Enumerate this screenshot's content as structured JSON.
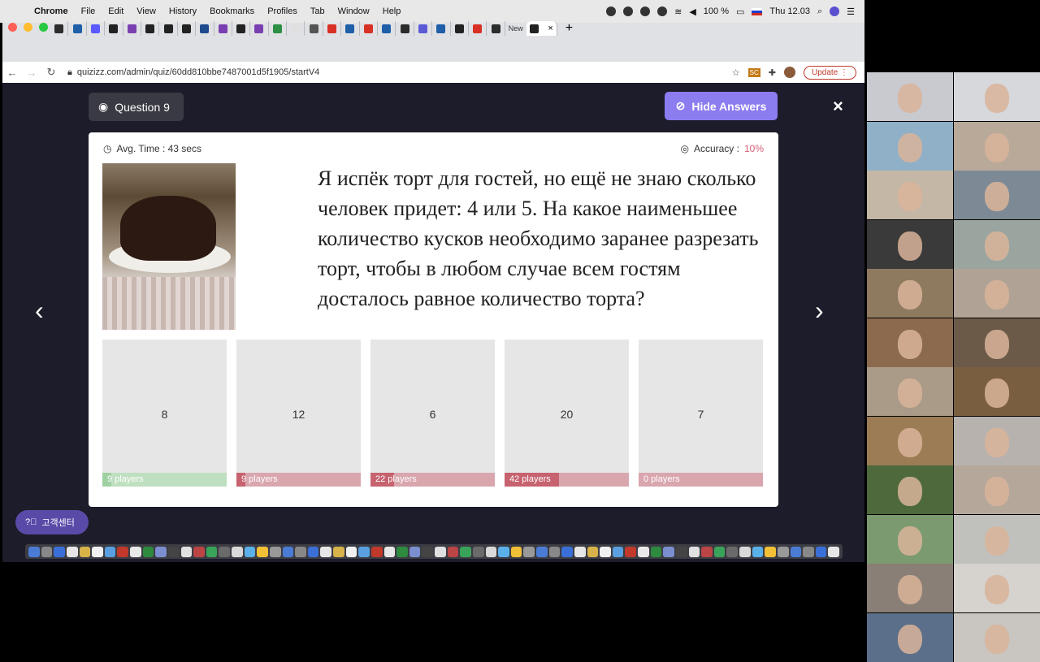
{
  "menubar": {
    "app": "Chrome",
    "items": [
      "File",
      "Edit",
      "View",
      "History",
      "Bookmarks",
      "Profiles",
      "Tab",
      "Window",
      "Help"
    ],
    "battery": "100 %",
    "clock": "Thu 12.03"
  },
  "browser": {
    "url": "quizizz.com/admin/quiz/60dd810bbe7487001d5f1905/startV4",
    "new_tab_label": "New",
    "update_label": "Update",
    "tab_colors": [
      "#2c2c2c",
      "#1f5fa8",
      "#5a5aff",
      "#222",
      "#7a3fb0",
      "#222",
      "#222",
      "#222",
      "#1d4b8e",
      "#7a3fb0",
      "#222",
      "#7a3fb0",
      "#2c8f44",
      "#e0e0e0",
      "#555",
      "#d93025",
      "#1f5fa8",
      "#d93025",
      "#1f5fa8",
      "#2c2c2c",
      "#5b5bd6",
      "#1f5fa8",
      "#222",
      "#d93025",
      "#2c2c2c"
    ]
  },
  "quiz": {
    "question_label": "Question 9",
    "hide_answers_label": "Hide Answers",
    "avg_time": "Avg. Time : 43 secs",
    "accuracy_label": "Accuracy :",
    "accuracy_value": "10%",
    "question_text": "Я испёк торт для гостей, но ещё не знаю сколько человек придет: 4 или 5. На какое наименьшее количество кусков необходимо заранее разрезать торт, чтобы в любом случае всем гостям досталось равное количество торта?",
    "options": [
      {
        "answer": "8",
        "players": "9 players",
        "fraction": 0.07,
        "correct": true
      },
      {
        "answer": "12",
        "players": "9 players",
        "fraction": 0.07,
        "correct": false
      },
      {
        "answer": "6",
        "players": "22 players",
        "fraction": 0.19,
        "correct": false
      },
      {
        "answer": "20",
        "players": "42 players",
        "fraction": 0.44,
        "correct": false
      },
      {
        "answer": "7",
        "players": "0 players",
        "fraction": 0.0,
        "correct": false
      }
    ],
    "help_label": "고객센터"
  },
  "colors": {
    "correct_bar": "#bfe0c0",
    "correct_fill": "#9fd0a2",
    "wrong_bar": "#d9a6ae",
    "wrong_fill": "#c7626f",
    "accent": "#8b7cf0"
  },
  "gallery_colors": [
    "#c9cad0",
    "#d7d8dc",
    "#8fb0c7",
    "#b9a998",
    "#c5b7a6",
    "#7d8a96",
    "#3a3a3a",
    "#9aa5a0",
    "#8e7a5f",
    "#b0a396",
    "#8c6a4e",
    "#6c5a48",
    "#aa9a88",
    "#7a5e40",
    "#9b7c55",
    "#b8b2ae",
    "#4e6a3c",
    "#b5a79a",
    "#7b9a70",
    "#c0c1bd",
    "#8a7f76",
    "#d6d2cd",
    "#5b6f8a",
    "#c9c5c0"
  ]
}
